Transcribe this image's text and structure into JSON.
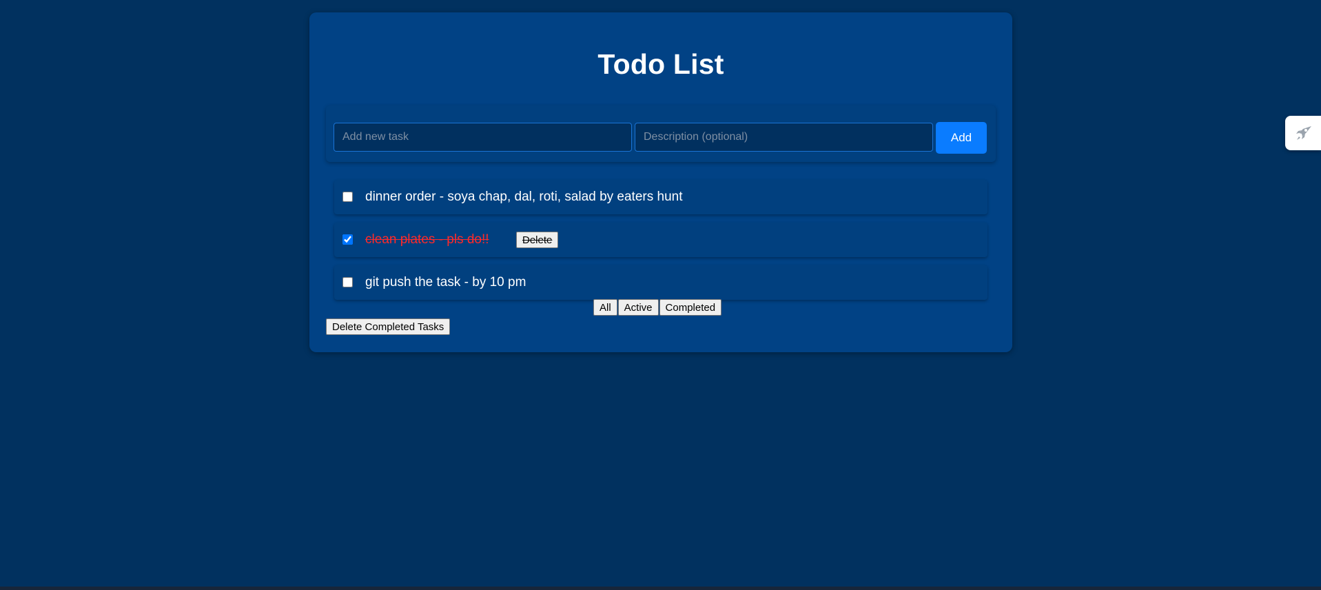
{
  "app": {
    "title": "Todo List"
  },
  "inputs": {
    "task_placeholder": "Add new task",
    "task_value": "",
    "description_placeholder": "Description (optional)",
    "description_value": "",
    "add_label": "Add"
  },
  "todos": [
    {
      "text": "dinner order - soya chap, dal, roti, salad by eaters hunt",
      "completed": false
    },
    {
      "text": "clean plates - pls do!!",
      "completed": true,
      "delete_label": "Delete"
    },
    {
      "text": "git push the task - by 10 pm",
      "completed": false
    }
  ],
  "filters": {
    "all": "All",
    "active": "Active",
    "completed": "Completed"
  },
  "actions": {
    "delete_completed": "Delete Completed Tasks"
  },
  "side_widget": {
    "icon": "rocket-icon"
  },
  "colors": {
    "page_bg": "#01315f",
    "card_bg": "#014285",
    "accent": "#0a7cff",
    "completed_text": "#ff2a2a"
  }
}
